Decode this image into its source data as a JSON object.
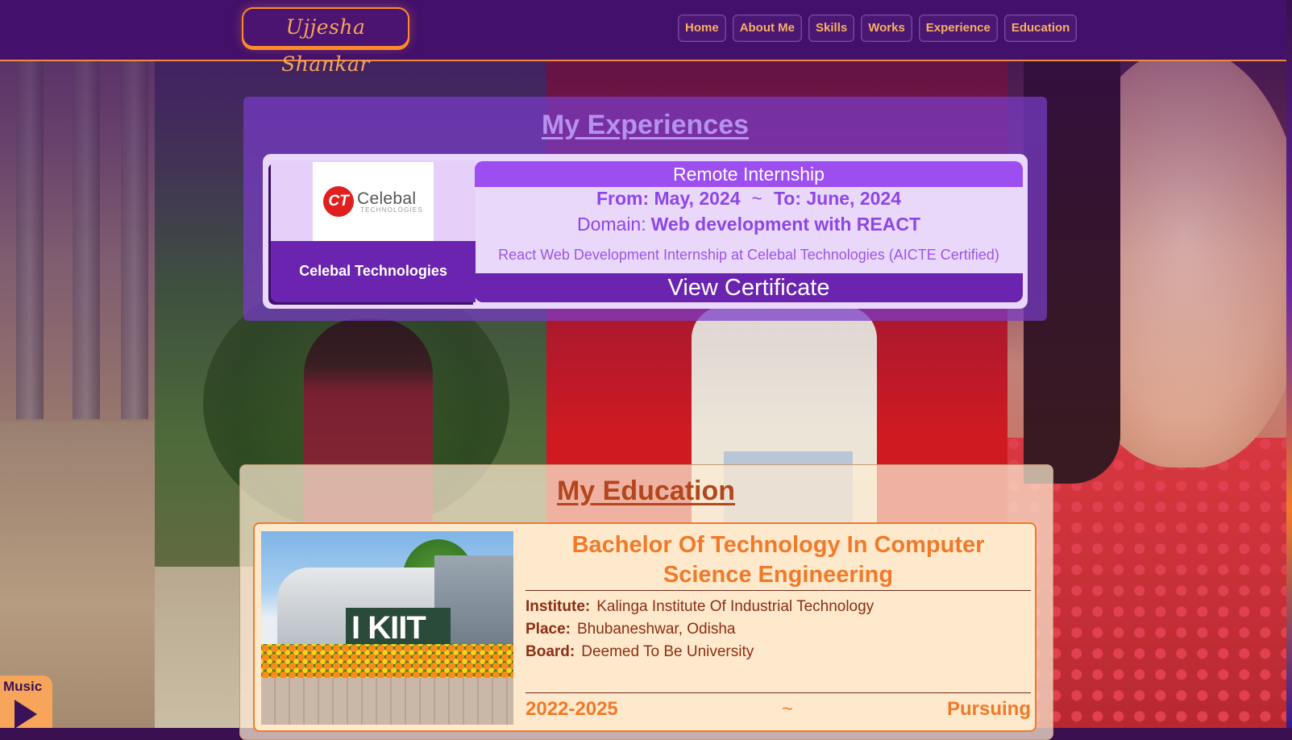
{
  "header": {
    "logo": "Ujjesha Shankar",
    "nav": [
      "Home",
      "About Me",
      "Skills",
      "Works",
      "Experience",
      "Education"
    ]
  },
  "experience": {
    "title": "My Experiences",
    "items": [
      {
        "company": "Celebal Technologies",
        "logo_mark": "CT",
        "logo_name": "Celebal",
        "logo_sub": "TECHNOLOGIES",
        "type": "Remote Internship",
        "from": "From: May, 2024",
        "separator": "~",
        "to": "To: June, 2024",
        "domain_label": "Domain:",
        "domain": "Web development with REACT",
        "description": "React Web Development Internship at Celebal Technologies (AICTE Certified)",
        "cta": "View Certificate"
      }
    ]
  },
  "education": {
    "title": "My Education",
    "items": [
      {
        "degree": "Bachelor Of Technology In Computer Science Engineering",
        "image_text": "I KIIT",
        "institute_label": "Institute:",
        "institute": "Kalinga Institute Of Industrial Technology",
        "place_label": "Place:",
        "place": "Bhubaneshwar, Odisha",
        "board_label": "Board:",
        "board": "Deemed To Be University",
        "years": "2022-2025",
        "separator": "~",
        "status": "Pursuing"
      }
    ]
  },
  "music": {
    "label": "Music",
    "icon": "play-icon"
  },
  "colors": {
    "accent": "#f07a2a",
    "purple": "#43106b",
    "violet": "#8d46e6"
  }
}
